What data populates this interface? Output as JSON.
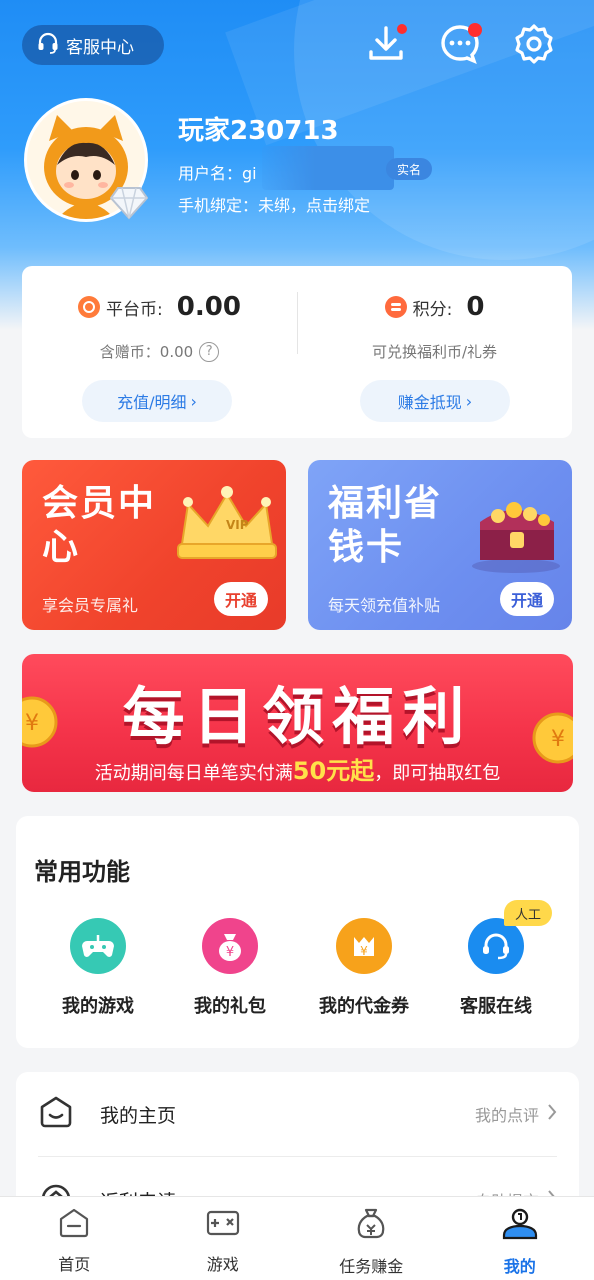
{
  "colors": {
    "accent": "#1a73e8",
    "vip_red": "#f0432c",
    "welfare_blue": "#6d8ff0",
    "banner_red": "#f5344a",
    "highlight": "#ffe14a"
  },
  "header": {
    "customer_service_label": "客服中心",
    "icons": [
      "headset-icon",
      "download-icon",
      "message-icon",
      "settings-icon"
    ]
  },
  "profile": {
    "nickname": "玩家230713",
    "username": "用户名：gi",
    "realname_tag": "实名",
    "phone": "手机绑定：未绑，点击绑定"
  },
  "wallet": {
    "platform_label": "平台币:",
    "platform_value": "0.00",
    "gift_label": "含赠币：0.00",
    "recharge_btn": "充值/明细",
    "points_label": "积分:",
    "points_value": "0",
    "points_desc": "可兑换福利币/礼券",
    "earn_btn": "赚金抵现"
  },
  "cards": {
    "vip": {
      "title": "会员中心",
      "sub": "享会员专属礼",
      "btn": "开通",
      "crown": "VIP"
    },
    "welfare": {
      "title": "福利省钱卡",
      "sub": "每天领充值补贴",
      "btn": "开通"
    }
  },
  "banner": {
    "title": "每日领福利",
    "sub_before": "活动期间每日单笔实付满",
    "sub_highlight": "50元起",
    "sub_after": "，即可抽取红包"
  },
  "common": {
    "title": "常用功能",
    "items": [
      {
        "label": "我的游戏",
        "icon": "game-controller-icon",
        "color": "#36c9b4"
      },
      {
        "label": "我的礼包",
        "icon": "gift-bag-icon",
        "color": "#f0448c"
      },
      {
        "label": "我的代金券",
        "icon": "voucher-icon",
        "color": "#f7a21b"
      },
      {
        "label": "客服在线",
        "icon": "customer-service-icon",
        "color": "#1a8cf0"
      }
    ],
    "badge": "人工"
  },
  "list": [
    {
      "label": "我的主页",
      "right": "我的点评",
      "icon": "home-face-icon"
    },
    {
      "label": "返利申请",
      "right": "自助提交",
      "icon": "rebate-icon"
    }
  ],
  "tabbar": [
    {
      "label": "首页",
      "icon": "home-icon",
      "active": false
    },
    {
      "label": "游戏",
      "icon": "gamepad-icon",
      "active": false
    },
    {
      "label": "任务赚金",
      "icon": "money-bag-icon",
      "active": false
    },
    {
      "label": "我的",
      "icon": "profile-icon",
      "active": true
    }
  ]
}
